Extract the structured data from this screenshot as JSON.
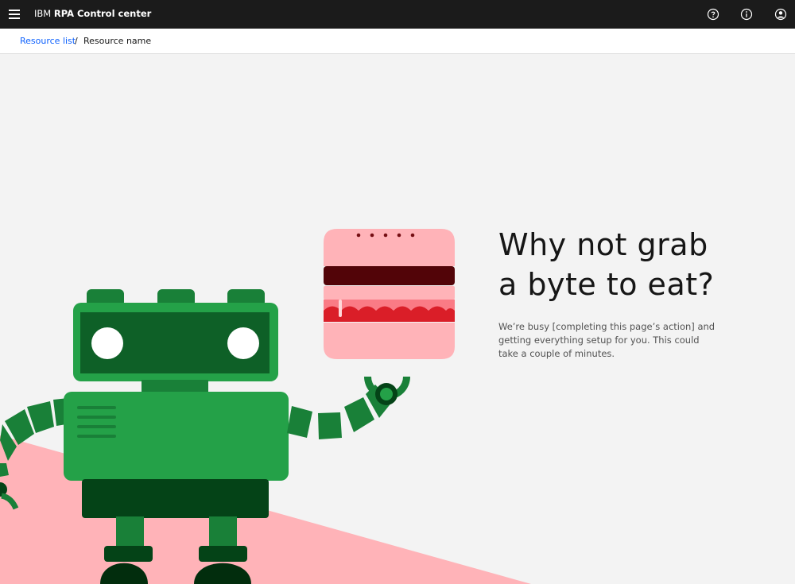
{
  "header": {
    "menu_icon": "hamburger-menu-icon",
    "brand_prefix": "IBM",
    "brand_product": "RPA Control center",
    "icons": [
      "help-icon",
      "info-icon",
      "user-avatar-icon"
    ]
  },
  "breadcrumb": {
    "link_label": "Resource list",
    "separator": "/",
    "current_label": "Resource name"
  },
  "empty_state": {
    "headline_line1": "Why not grab",
    "headline_line2": "a byte to eat?",
    "message": "We’re busy [completing this page’s action] and getting everything setup for you. This could take a couple of minutes."
  },
  "colors": {
    "topbar": "#1b1b1b",
    "link": "#0f62fe",
    "background": "#f3f3f3",
    "robot_green": "#24a148",
    "robot_dark_green": "#0e6027",
    "robot_darkest_green": "#044317",
    "burger_pink": "#ffb3b8",
    "patty": "#520408",
    "sauce": "#da1e28"
  }
}
